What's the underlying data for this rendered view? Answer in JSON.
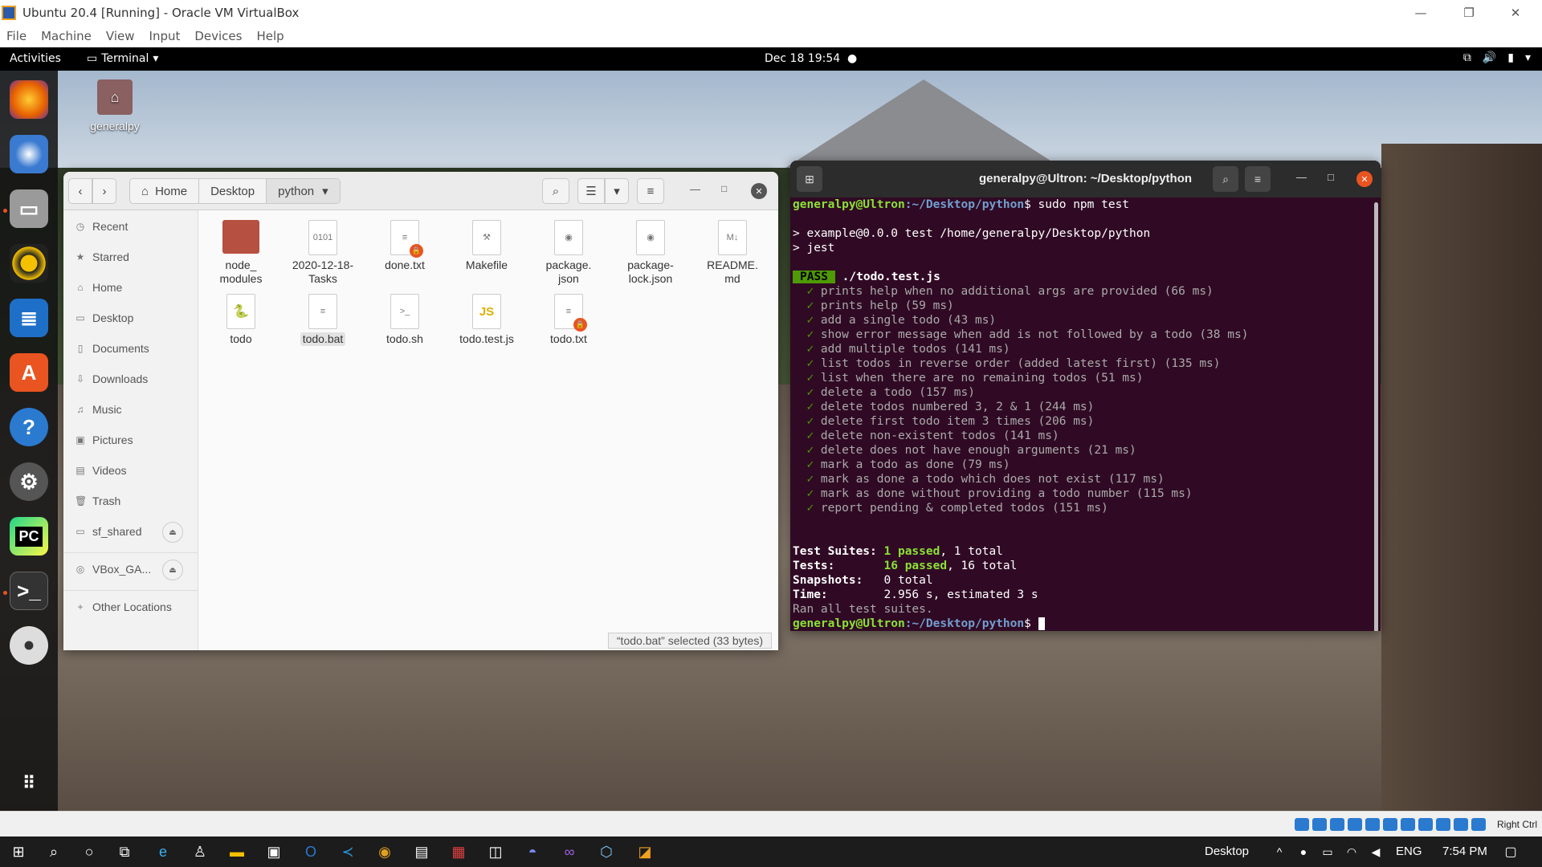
{
  "host": {
    "title": "Ubuntu 20.4 [Running] - Oracle VM VirtualBox",
    "menu": [
      "File",
      "Machine",
      "View",
      "Input",
      "Devices",
      "Help"
    ]
  },
  "topbar": {
    "activities": "Activities",
    "app": "Terminal",
    "clock": "Dec 18  19:54"
  },
  "desktop": {
    "home_label": "generalpy"
  },
  "files": {
    "path": [
      "Home",
      "Desktop",
      "python"
    ],
    "sidebar": [
      "Recent",
      "Starred",
      "Home",
      "Desktop",
      "Documents",
      "Downloads",
      "Music",
      "Pictures",
      "Videos",
      "Trash",
      "sf_shared",
      "VBox_GA...",
      "Other Locations"
    ],
    "items": [
      {
        "name": "node_\nmodules",
        "kind": "folder"
      },
      {
        "name": "2020-12-18-\nTasks",
        "kind": "binary"
      },
      {
        "name": "done.txt",
        "kind": "locked-text"
      },
      {
        "name": "Makefile",
        "kind": "makefile"
      },
      {
        "name": "package.\njson",
        "kind": "json"
      },
      {
        "name": "package-\nlock.json",
        "kind": "json"
      },
      {
        "name": "README.\nmd",
        "kind": "markdown"
      },
      {
        "name": "todo",
        "kind": "python"
      },
      {
        "name": "todo.bat",
        "kind": "text"
      },
      {
        "name": "todo.sh",
        "kind": "script"
      },
      {
        "name": "todo.test.js",
        "kind": "js"
      },
      {
        "name": "todo.txt",
        "kind": "locked-text"
      }
    ],
    "status": "“todo.bat” selected  (33 bytes)"
  },
  "terminal": {
    "title": "generalpy@Ultron: ~/Desktop/python",
    "user": "generalpy@Ultron",
    "path": ":~/Desktop/python",
    "cmd": "$ sudo npm test",
    "line1": "> example@0.0.0 test /home/generalpy/Desktop/python",
    "line2": "> jest",
    "pass_badge": "PASS",
    "test_file": " ./todo.test.js",
    "tests": [
      "prints help when no additional args are provided (66 ms)",
      "prints help (59 ms)",
      "add a single todo (43 ms)",
      "show error message when add is not followed by a todo (38 ms)",
      "add multiple todos (141 ms)",
      "list todos in reverse order (added latest first) (135 ms)",
      "list when there are no remaining todos (51 ms)",
      "delete a todo (157 ms)",
      "delete todos numbered 3, 2 & 1 (244 ms)",
      "delete first todo item 3 times (206 ms)",
      "delete non-existent todos (141 ms)",
      "delete does not have enough arguments (21 ms)",
      "mark a todo as done (79 ms)",
      "mark as done a todo which does not exist (117 ms)",
      "mark as done without providing a todo number (115 ms)",
      "report pending & completed todos (151 ms)"
    ],
    "suites_label": "Test Suites:",
    "suites_passed": "1 passed",
    "suites_total": ", 1 total",
    "tests_label": "Tests:",
    "tests_passed": "16 passed",
    "tests_total": ", 16 total",
    "snap_label": "Snapshots:",
    "snap_val": "0 total",
    "time_label": "Time:",
    "time_val": "2.956 s, estimated 3 s",
    "ran": "Ran all test suites.",
    "prompt_end": "$ "
  },
  "vbox_status": {
    "hostkey": "Right Ctrl"
  },
  "taskbar": {
    "desktop": "Desktop",
    "lang": "ENG",
    "time": "7:54 PM"
  },
  "colors": {
    "ubuntu_orange": "#e95420",
    "terminal_bg": "#300a24",
    "prompt_green": "#8ae234",
    "prompt_blue": "#729fcf"
  }
}
